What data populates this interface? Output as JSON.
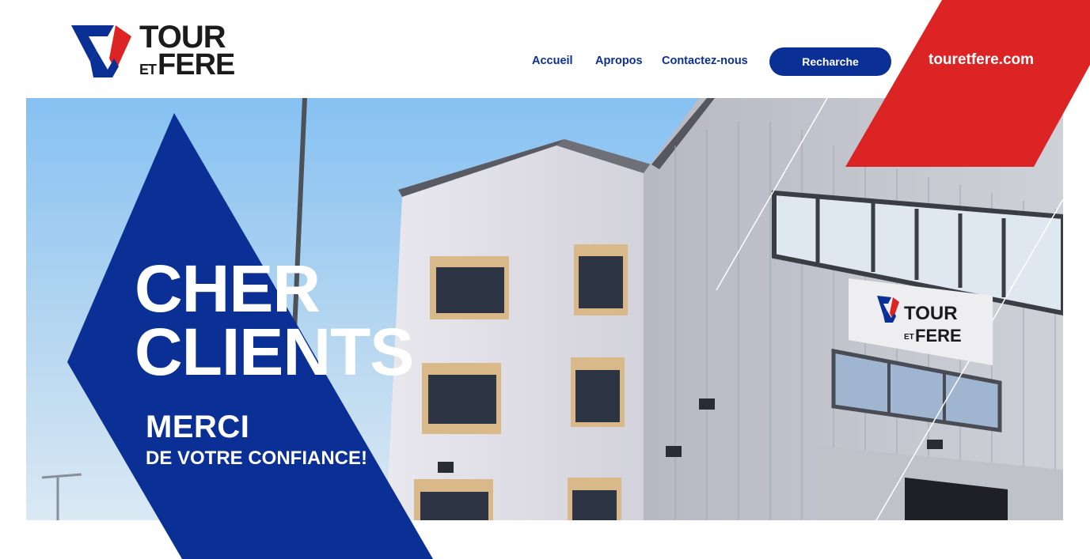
{
  "brand": {
    "logo_line1": "TOUR",
    "logo_et": "ET",
    "logo_line2": "FERE"
  },
  "nav": {
    "items": [
      {
        "label": "Accueil"
      },
      {
        "label": "Apropos"
      },
      {
        "label": "Contactez-nous"
      }
    ],
    "search_label": "Recharche",
    "domain": "touretfere.com"
  },
  "hero": {
    "headline_line1": "CHER",
    "headline_line2": "CLIENTS",
    "sub_line1": "MERCI",
    "sub_line2": "DE VOTRE CONFIANCE!",
    "sign_line1": "TOUR",
    "sign_et": "ET",
    "sign_line2": "FERE"
  },
  "colors": {
    "brand_blue": "#0a2f95",
    "brand_red": "#dd2424",
    "text_dark": "#1b1b1b"
  }
}
